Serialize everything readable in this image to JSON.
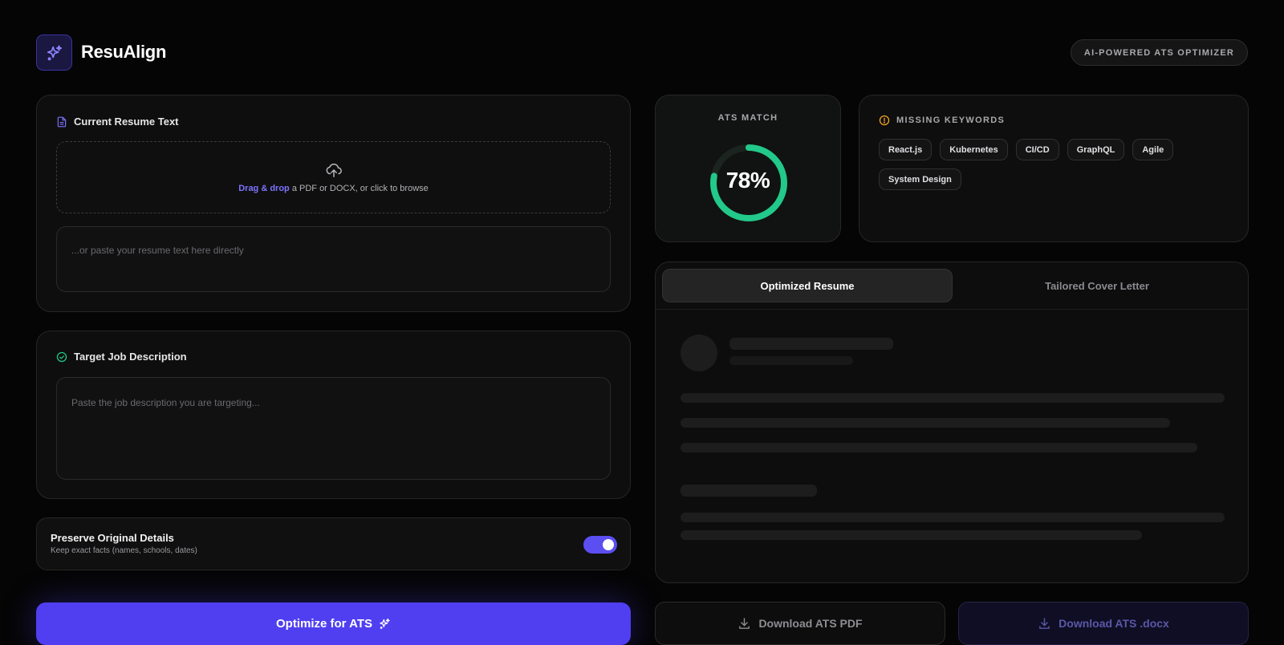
{
  "header": {
    "brand": "ResuAlign",
    "badge": "AI-POWERED ATS OPTIMIZER"
  },
  "resume": {
    "title": "Current Resume Text",
    "dropzone_link": "Drag & drop",
    "dropzone_text": " a PDF or DOCX, or click to browse",
    "paste_placeholder": "...or paste your resume text here directly"
  },
  "job": {
    "title": "Target Job Description",
    "placeholder": "Paste the job description you are targeting..."
  },
  "preserve": {
    "title": "Preserve Original Details",
    "subtitle": "Keep exact facts (names, schools, dates)",
    "enabled": true
  },
  "optimize_button": "Optimize for ATS",
  "score": {
    "label": "ATS MATCH",
    "value": "78%",
    "percent": 78,
    "color": "#22c98a"
  },
  "keywords": {
    "title": "MISSING KEYWORDS",
    "items": [
      "React.js",
      "Kubernetes",
      "CI/CD",
      "GraphQL",
      "Agile",
      "System Design"
    ]
  },
  "result": {
    "tabs": [
      "Optimized Resume",
      "Tailored Cover Letter"
    ],
    "active_tab": 0
  },
  "downloads": {
    "pdf": "Download ATS PDF",
    "docx": "Download ATS .docx"
  },
  "colors": {
    "accent": "#4f3ff0",
    "link": "#7c74ff",
    "success": "#22c98a",
    "warning": "#f5a524"
  }
}
